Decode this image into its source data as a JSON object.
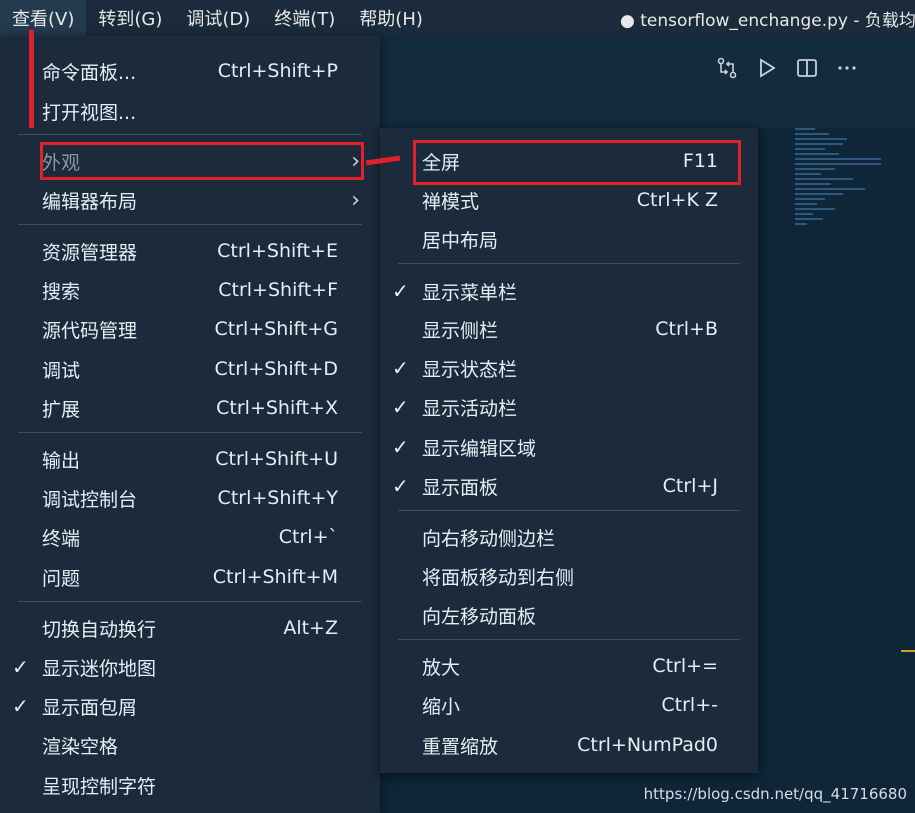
{
  "menubar": {
    "items": [
      {
        "label": "查看(V)"
      },
      {
        "label": "转到(G)"
      },
      {
        "label": "调试(D)"
      },
      {
        "label": "终端(T)"
      },
      {
        "label": "帮助(H)"
      }
    ],
    "window_title": "● tensorflow_enchange.py - 负载均衡"
  },
  "view_menu": {
    "items": [
      {
        "label": "命令面板...",
        "shortcut": "Ctrl+Shift+P"
      },
      {
        "label": "打开视图...",
        "shortcut": ""
      },
      {
        "label": "外观",
        "shortcut": ""
      },
      {
        "label": "编辑器布局",
        "shortcut": ""
      },
      {
        "label": "资源管理器",
        "shortcut": "Ctrl+Shift+E"
      },
      {
        "label": "搜索",
        "shortcut": "Ctrl+Shift+F"
      },
      {
        "label": "源代码管理",
        "shortcut": "Ctrl+Shift+G"
      },
      {
        "label": "调试",
        "shortcut": "Ctrl+Shift+D"
      },
      {
        "label": "扩展",
        "shortcut": "Ctrl+Shift+X"
      },
      {
        "label": "输出",
        "shortcut": "Ctrl+Shift+U"
      },
      {
        "label": "调试控制台",
        "shortcut": "Ctrl+Shift+Y"
      },
      {
        "label": "终端",
        "shortcut": "Ctrl+`"
      },
      {
        "label": "问题",
        "shortcut": "Ctrl+Shift+M"
      },
      {
        "label": "切换自动换行",
        "shortcut": "Alt+Z"
      },
      {
        "label": "显示迷你地图",
        "shortcut": "",
        "checked": true
      },
      {
        "label": "显示面包屑",
        "shortcut": "",
        "checked": true
      },
      {
        "label": "渲染空格",
        "shortcut": ""
      },
      {
        "label": "呈现控制字符",
        "shortcut": ""
      }
    ],
    "check_glyph": "✓",
    "submenu_arrow": "›"
  },
  "appearance_menu": {
    "items": [
      {
        "label": "全屏",
        "shortcut": "F11"
      },
      {
        "label": "禅模式",
        "shortcut": "Ctrl+K Z"
      },
      {
        "label": "居中布局",
        "shortcut": ""
      },
      {
        "label": "显示菜单栏",
        "shortcut": "",
        "checked": true
      },
      {
        "label": "显示侧栏",
        "shortcut": "Ctrl+B"
      },
      {
        "label": "显示状态栏",
        "shortcut": "",
        "checked": true
      },
      {
        "label": "显示活动栏",
        "shortcut": "",
        "checked": true
      },
      {
        "label": "显示编辑区域",
        "shortcut": "",
        "checked": true
      },
      {
        "label": "显示面板",
        "shortcut": "Ctrl+J",
        "checked": true
      },
      {
        "label": "向右移动侧边栏",
        "shortcut": ""
      },
      {
        "label": "将面板移动到右侧",
        "shortcut": ""
      },
      {
        "label": "向左移动面板",
        "shortcut": ""
      },
      {
        "label": "放大",
        "shortcut": "Ctrl+="
      },
      {
        "label": "缩小",
        "shortcut": "Ctrl+-"
      },
      {
        "label": "重置缩放",
        "shortcut": "Ctrl+NumPad0"
      }
    ]
  },
  "toolbar": {
    "icons": [
      "compare-changes-icon",
      "run-icon",
      "split-editor-icon",
      "more-actions-icon"
    ]
  },
  "watermark": "https://blog.csdn.net/qq_41716680",
  "colors": {
    "menu_bg": "#1b2b3b",
    "editor_bg": "#0e2638",
    "highlight_red": "#e0202a"
  }
}
